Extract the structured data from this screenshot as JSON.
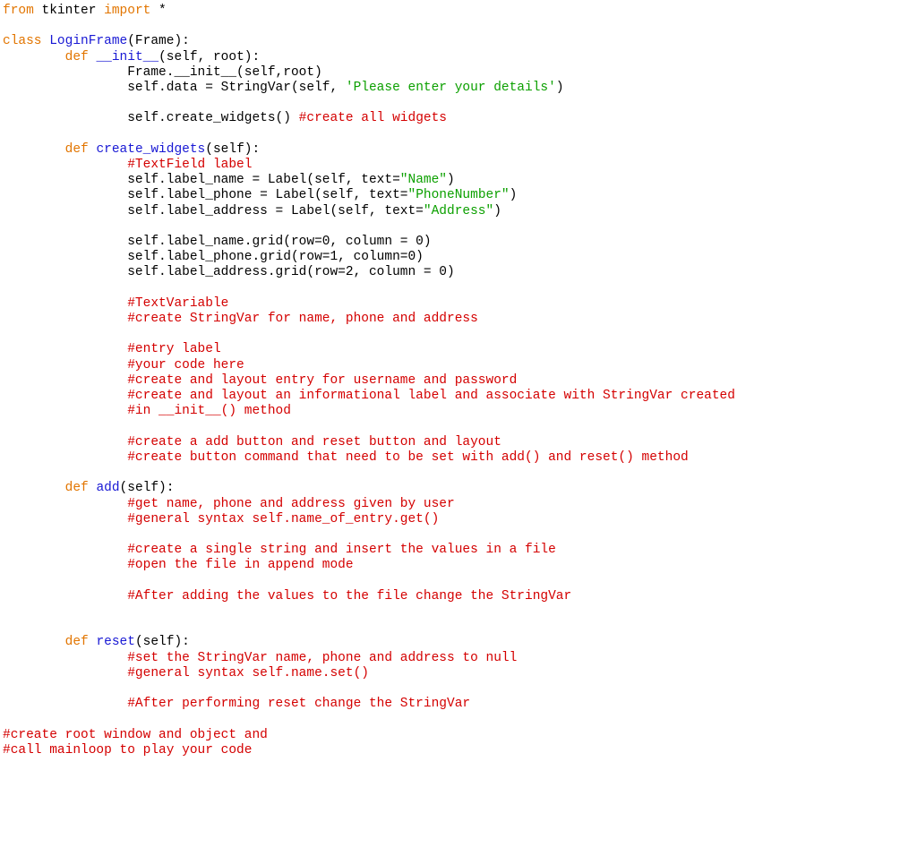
{
  "tokens": {
    "kw_from": "from",
    "mod_tkinter": "tkinter",
    "kw_import": "import",
    "star": " *",
    "kw_class": "class",
    "cls_LoginFrame": "LoginFrame",
    "paren_Frame": "(Frame):",
    "kw_def": "def",
    "fn_init": "__init__",
    "sig_init": "(self, root):",
    "line_frame_init": "Frame.__init__(self,root)",
    "line_selfdata_pre": "self.data = StringVar(self, ",
    "str_please": "'Please enter your details'",
    "close_paren": ")",
    "line_create_widgets_call": "self.create_widgets() ",
    "cmt_create_all": "#create all widgets",
    "fn_create_widgets": "create_widgets",
    "sig_self": "(self):",
    "cmt_textfield_label": "#TextField label",
    "line_label_name_pre": "self.label_name = Label(self, text=",
    "str_name": "\"Name\"",
    "line_label_phone_pre": "self.label_phone = Label(self, text=",
    "str_phonenum": "\"PhoneNumber\"",
    "line_label_address_pre": "self.label_address = Label(self, text=",
    "str_address": "\"Address\"",
    "line_grid_name": "self.label_name.grid(row=0, column = 0)",
    "line_grid_phone": "self.label_phone.grid(row=1, column=0)",
    "line_grid_address": "self.label_address.grid(row=2, column = 0)",
    "cmt_textvar": "#TextVariable",
    "cmt_create_strvar": "#create StringVar for name, phone and address",
    "cmt_entry_label": "#entry label",
    "cmt_your_code": "#your code here",
    "cmt_layout_entry": "#create and layout entry for username and password",
    "cmt_layout_info": "#create and layout an informational label and associate with StringVar created",
    "cmt_in_init": "#in __init__() method",
    "cmt_add_reset_btn": "#create a add button and reset button and layout",
    "cmt_btn_cmd": "#create button command that need to be set with add() and reset() method",
    "fn_add": "add",
    "cmt_get_vals": "#get name, phone and address given by user",
    "cmt_syntax_get": "#general syntax self.name_of_entry.get()",
    "cmt_single_string": "#create a single string and insert the values in a file",
    "cmt_open_file": "#open the file in append mode",
    "cmt_after_add": "#After adding the values to the file change the StringVar",
    "fn_reset": "reset",
    "cmt_set_null": "#set the StringVar name, phone and address to null",
    "cmt_syntax_set": "#general syntax self.name.set()",
    "cmt_after_reset": "#After performing reset change the StringVar",
    "cmt_root_window": "#create root window and object and",
    "cmt_mainloop": "#call mainloop to play your code"
  }
}
